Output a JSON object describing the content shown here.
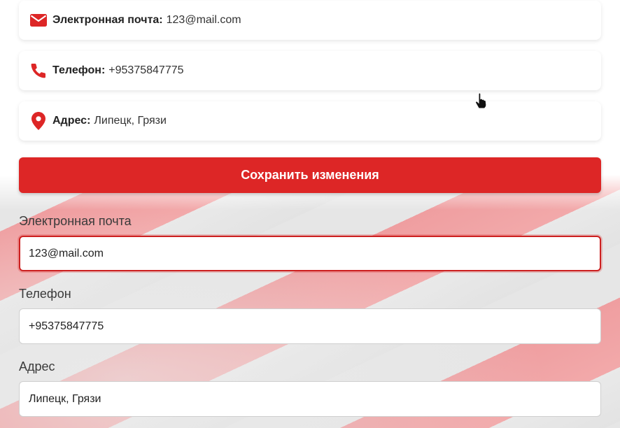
{
  "info": {
    "email": {
      "label": "Электронная почта:",
      "value": "123@mail.com",
      "icon": "envelope-icon"
    },
    "phone": {
      "label": "Телефон:",
      "value": "+95375847775",
      "icon": "phone-icon"
    },
    "address": {
      "label": "Адрес:",
      "value": "Липецк, Грязи",
      "icon": "map-pin-icon"
    }
  },
  "save_button": "Сохранить изменения",
  "form": {
    "email": {
      "label": "Электронная почта",
      "value": "123@mail.com"
    },
    "phone": {
      "label": "Телефон",
      "value": "+95375847775"
    },
    "address": {
      "label": "Адрес",
      "value": "Липецк, Грязи"
    }
  },
  "colors": {
    "accent": "#dd2626",
    "icon": "#dd2626"
  }
}
